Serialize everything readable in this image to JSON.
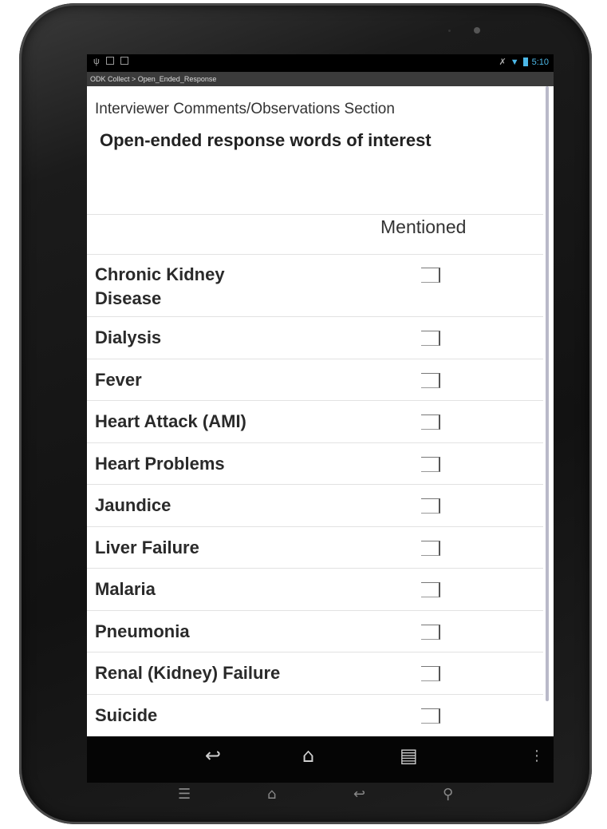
{
  "statusbar": {
    "time": "5:10"
  },
  "app": {
    "title": "ODK Collect > Open_Ended_Response"
  },
  "form": {
    "section_hint": "Interviewer Comments/Observations Section",
    "question": "Open-ended response words of interest",
    "column_header": "Mentioned",
    "items": [
      {
        "label": "Chronic Kidney Disease",
        "checked": false
      },
      {
        "label": "Dialysis",
        "checked": false
      },
      {
        "label": "Fever",
        "checked": false
      },
      {
        "label": "Heart Attack (AMI)",
        "checked": false
      },
      {
        "label": "Heart Problems",
        "checked": false
      },
      {
        "label": "Jaundice",
        "checked": false
      },
      {
        "label": "Liver Failure",
        "checked": false
      },
      {
        "label": "Malaria",
        "checked": false
      },
      {
        "label": "Pneumonia",
        "checked": false
      },
      {
        "label": "Renal (Kidney) Failure",
        "checked": false
      },
      {
        "label": "Suicide",
        "checked": false
      }
    ]
  },
  "navbar": {
    "icons": [
      "back-icon",
      "home-icon",
      "recents-icon",
      "overflow-menu-icon"
    ]
  },
  "hardware_keys": {
    "icons": [
      "menu-key-icon",
      "home-key-icon",
      "back-key-icon",
      "search-key-icon"
    ]
  },
  "colors": {
    "status_accent": "#4cb8e8",
    "titlebar_bg": "#3b3b3b",
    "screen_bg": "#ffffff"
  }
}
